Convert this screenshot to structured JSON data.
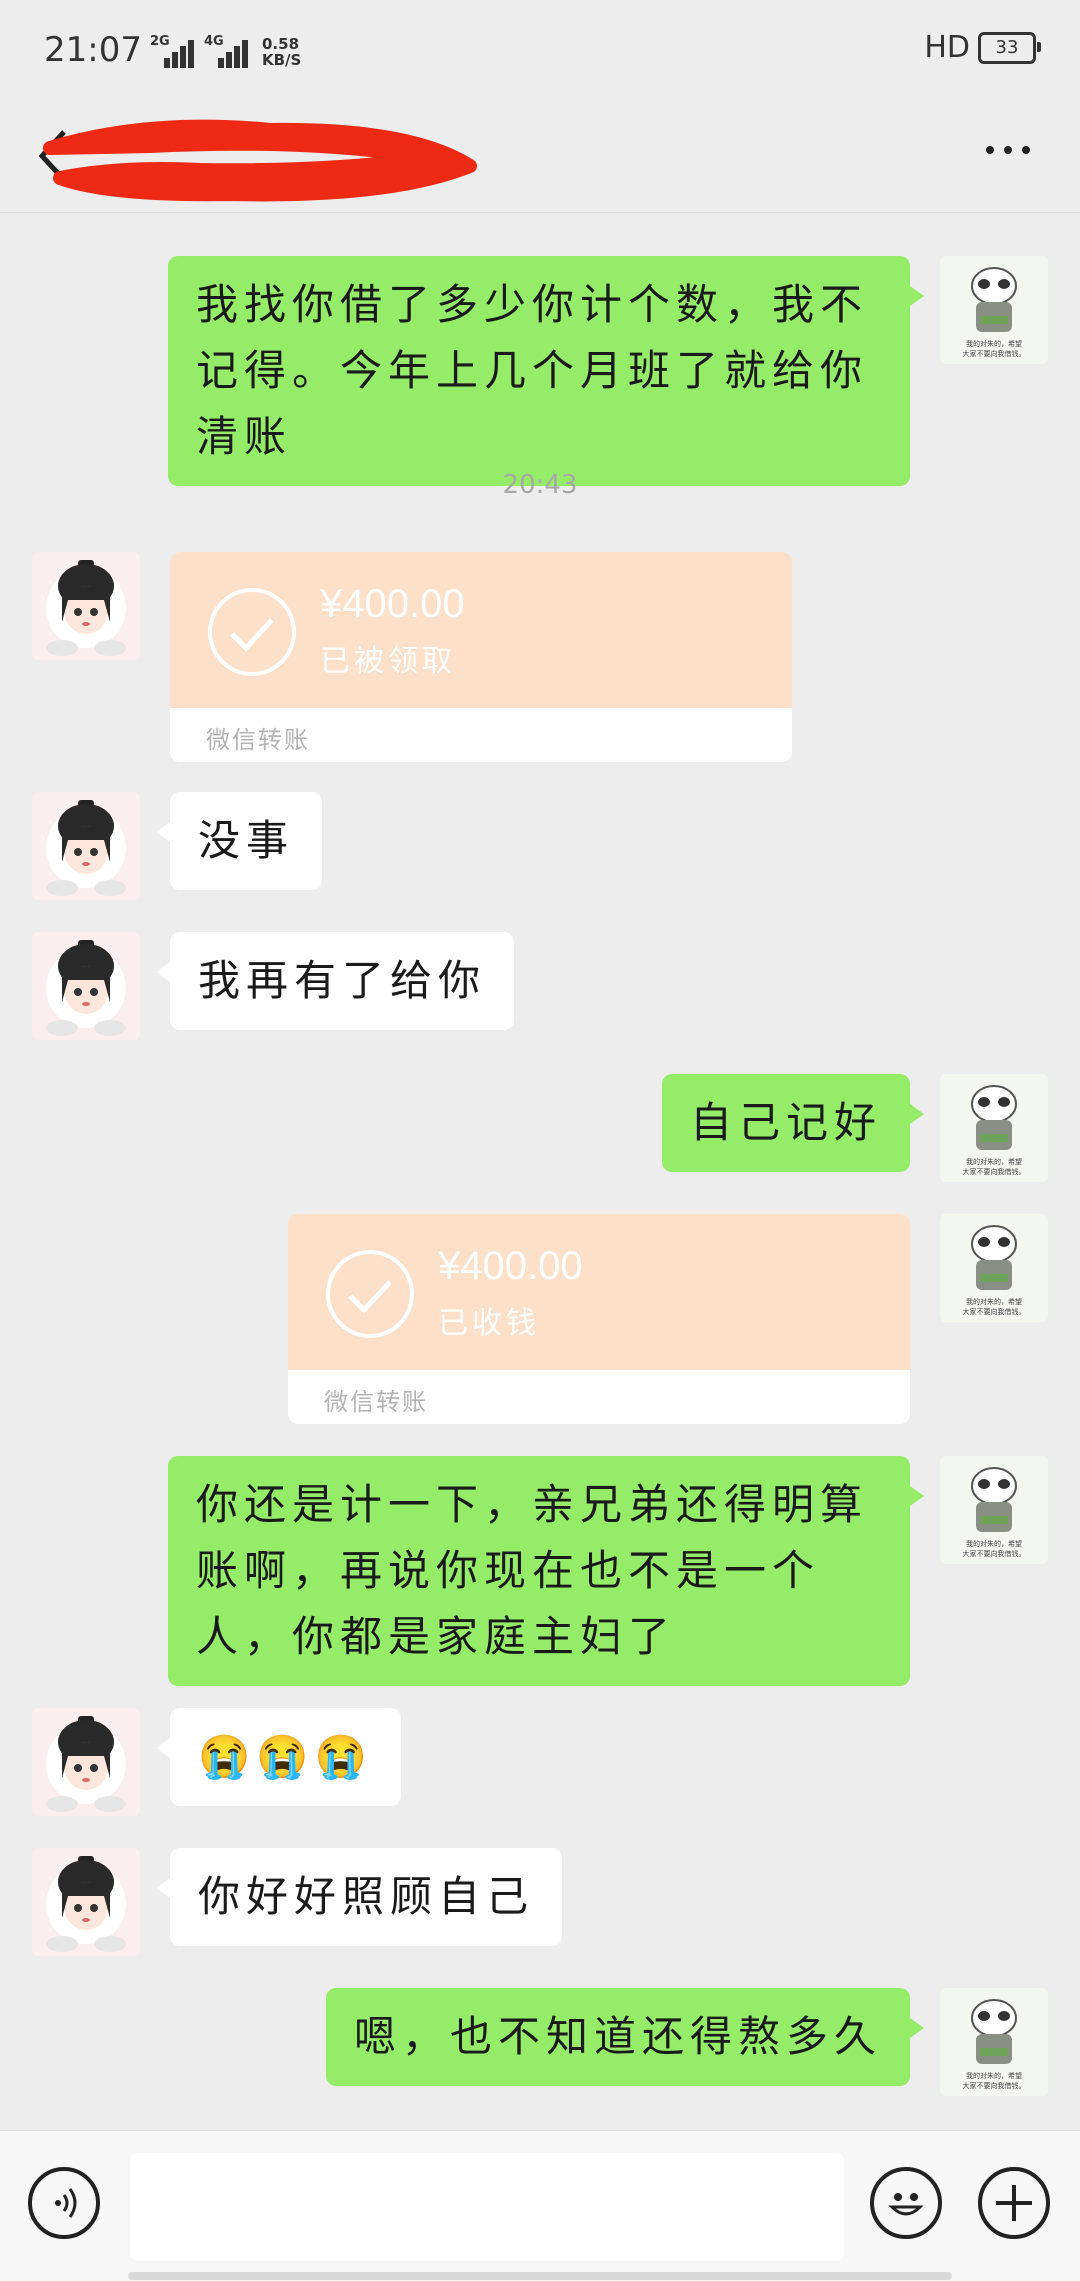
{
  "status_bar": {
    "time": "21:07",
    "sim1": "2G",
    "sim2": "4G",
    "speed_value": "0.58",
    "speed_unit": "KB/S",
    "hd": "HD",
    "battery": "33"
  },
  "colors": {
    "background": "#ededed",
    "sent_bubble": "#95ec69",
    "received_bubble": "#ffffff",
    "transfer_card": "#fde0c9",
    "redaction": "#ee2a14"
  },
  "messages": {
    "m1": "我找你借了多少你计个数，我不记得。今年上几个月班了就给你清账",
    "timestamp": "20:43",
    "transfer1": {
      "amount": "¥400.00",
      "status": "已被领取",
      "footer": "微信转账"
    },
    "m2": "没事",
    "m3": "我再有了给你",
    "m4": "自己记好",
    "transfer2": {
      "amount": "¥400.00",
      "status": "已收钱",
      "footer": "微信转账"
    },
    "m5": "你还是计一下，亲兄弟还得明算账啊，再说你现在也不是一个人，你都是家庭主妇了",
    "m6": "😭😭😭",
    "m7": "你好好照顾自己",
    "m8": "嗯，也不知道还得熬多久"
  },
  "avatar_caption": {
    "line1": "我的对朱的，希望",
    "line2": "大家不要向我借钱。"
  }
}
